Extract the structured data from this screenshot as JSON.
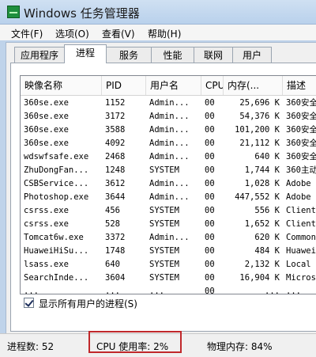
{
  "window": {
    "title": "Windows 任务管理器"
  },
  "menu": [
    "文件(F)",
    "选项(O)",
    "查看(V)",
    "帮助(H)"
  ],
  "tabs": [
    {
      "label": "应用程序",
      "active": false
    },
    {
      "label": "进程",
      "active": true
    },
    {
      "label": "服务",
      "active": false
    },
    {
      "label": "性能",
      "active": false
    },
    {
      "label": "联网",
      "active": false
    },
    {
      "label": "用户",
      "active": false
    }
  ],
  "table": {
    "columns": [
      "映像名称",
      "PID",
      "用户名",
      "CPU",
      "内存(...",
      "描述"
    ],
    "rows": [
      [
        "360se.exe",
        "1152",
        "Admin...",
        "00",
        "25,696 K",
        "360安全"
      ],
      [
        "360se.exe",
        "3172",
        "Admin...",
        "00",
        "54,376 K",
        "360安全"
      ],
      [
        "360se.exe",
        "3588",
        "Admin...",
        "00",
        "101,200 K",
        "360安全"
      ],
      [
        "360se.exe",
        "4092",
        "Admin...",
        "00",
        "21,112 K",
        "360安全"
      ],
      [
        "wdswfsafe.exe",
        "2468",
        "Admin...",
        "00",
        "640 K",
        "360安全"
      ],
      [
        "ZhuDongFan...",
        "1248",
        "SYSTEM",
        "00",
        "1,744 K",
        "360主动"
      ],
      [
        "CSBService...",
        "3612",
        "Admin...",
        "00",
        "1,028 K",
        "Adobe "
      ],
      [
        "Photoshop.exe",
        "3644",
        "Admin...",
        "00",
        "447,552 K",
        "Adobe P"
      ],
      [
        "csrss.exe",
        "456",
        "SYSTEM",
        "00",
        "556 K",
        "Client"
      ],
      [
        "csrss.exe",
        "528",
        "SYSTEM",
        "00",
        "1,652 K",
        "Client"
      ],
      [
        "Tomcat6w.exe",
        "3372",
        "Admin...",
        "00",
        "620 K",
        "Common"
      ],
      [
        "HuaweiHiSu...",
        "1748",
        "SYSTEM",
        "00",
        "484 K",
        "Huawei"
      ],
      [
        "lsass.exe",
        "640",
        "SYSTEM",
        "00",
        "2,132 K",
        "Local "
      ],
      [
        "SearchInde...",
        "3604",
        "SYSTEM",
        "00",
        "16,904 K",
        "Micros"
      ],
      [
        "...",
        "...",
        "...",
        "00",
        "...",
        "..."
      ]
    ]
  },
  "show_all_users": {
    "label": "显示所有用户的进程(S)",
    "checked": true
  },
  "status": {
    "processes": "进程数: 52",
    "cpu": "CPU 使用率: 2%",
    "memory": "物理内存: 84%"
  }
}
